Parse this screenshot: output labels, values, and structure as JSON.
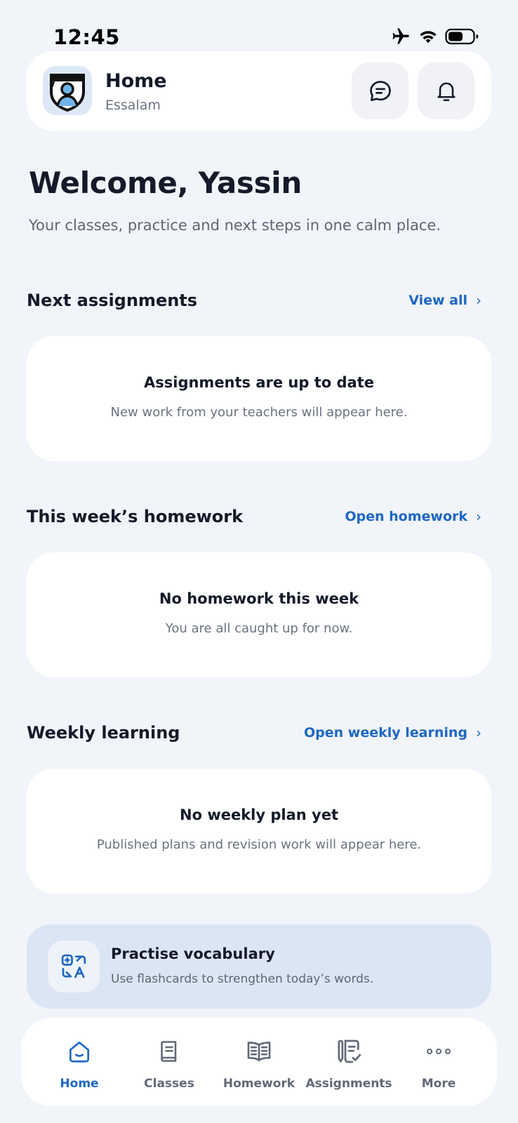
{
  "status_bar": {
    "time": "12:45"
  },
  "header": {
    "title": "Home",
    "subtitle": "Essalam"
  },
  "welcome": {
    "title": "Welcome, Yassin",
    "subtitle": "Your classes, practice and next steps in one calm place."
  },
  "sections": [
    {
      "title": "Next assignments",
      "link": "View all",
      "empty_title": "Assignments are up to date",
      "empty_desc": "New work from your teachers will appear here."
    },
    {
      "title": "This week’s homework",
      "link": "Open homework",
      "empty_title": "No homework this week",
      "empty_desc": "You are all caught up for now."
    },
    {
      "title": "Weekly learning",
      "link": "Open weekly learning",
      "empty_title": "No weekly plan yet",
      "empty_desc": "Published plans and revision work will appear here."
    }
  ],
  "vocab": {
    "title": "Practise vocabulary",
    "desc": "Use flashcards to strengthen today’s words."
  },
  "tabs": [
    {
      "label": "Home",
      "icon": "home-icon",
      "active": true
    },
    {
      "label": "Classes",
      "icon": "book-icon",
      "active": false
    },
    {
      "label": "Homework",
      "icon": "open-book-icon",
      "active": false
    },
    {
      "label": "Assignments",
      "icon": "checklist-icon",
      "active": false
    },
    {
      "label": "More",
      "icon": "more-dots-icon",
      "active": false
    }
  ],
  "colors": {
    "accent": "#1d67c2",
    "background": "#f1f4f9",
    "vocab_card": "#dbe5f4"
  }
}
